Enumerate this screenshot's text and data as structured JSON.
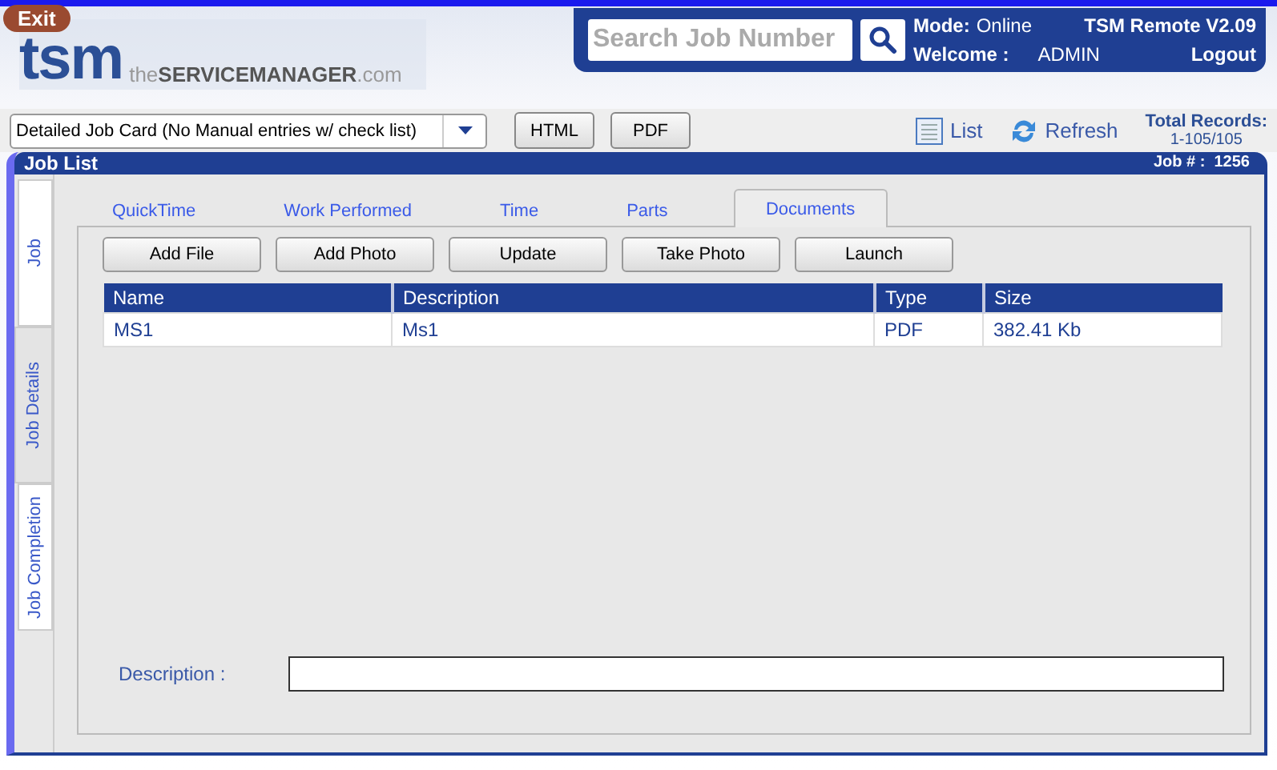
{
  "exit_button": "Exit",
  "logo": {
    "mark": "tsm",
    "text": "the**SERVICEMANAGER**.com"
  },
  "search": {
    "placeholder": "Search Job Number"
  },
  "status": {
    "mode_label": "Mode:",
    "mode_value": "Online",
    "version": "TSM Remote V2.09",
    "welcome_label": "Welcome :",
    "user": "ADMIN",
    "logout": "Logout"
  },
  "report_select": {
    "value": "Detailed Job Card (No Manual entries w/ check list)"
  },
  "export_buttons": [
    "HTML",
    "PDF"
  ],
  "list_link": "List",
  "refresh_link": "Refresh",
  "records": {
    "label": "Total Records:",
    "value": "1-105/105"
  },
  "panel": {
    "title": "Job List",
    "job_label": "Job # :",
    "job_number": "1256"
  },
  "side_tabs": [
    {
      "label": "Job",
      "selected": false
    },
    {
      "label": "Job Details",
      "selected": true
    },
    {
      "label": "Job Completion",
      "selected": false
    }
  ],
  "tabs": [
    {
      "label": "QuickTime",
      "selected": false
    },
    {
      "label": "Work Performed",
      "selected": false
    },
    {
      "label": "Time",
      "selected": false
    },
    {
      "label": "Parts",
      "selected": false
    },
    {
      "label": "Documents",
      "selected": true
    }
  ],
  "actions": [
    "Add File",
    "Add Photo",
    "Update",
    "Take Photo",
    "Launch"
  ],
  "table": {
    "columns": [
      "Name",
      "Description",
      "Type",
      "Size"
    ],
    "rows": [
      [
        "MS1",
        "Ms1",
        "PDF",
        "382.41 Kb"
      ]
    ]
  },
  "description": {
    "label": "Description :"
  }
}
